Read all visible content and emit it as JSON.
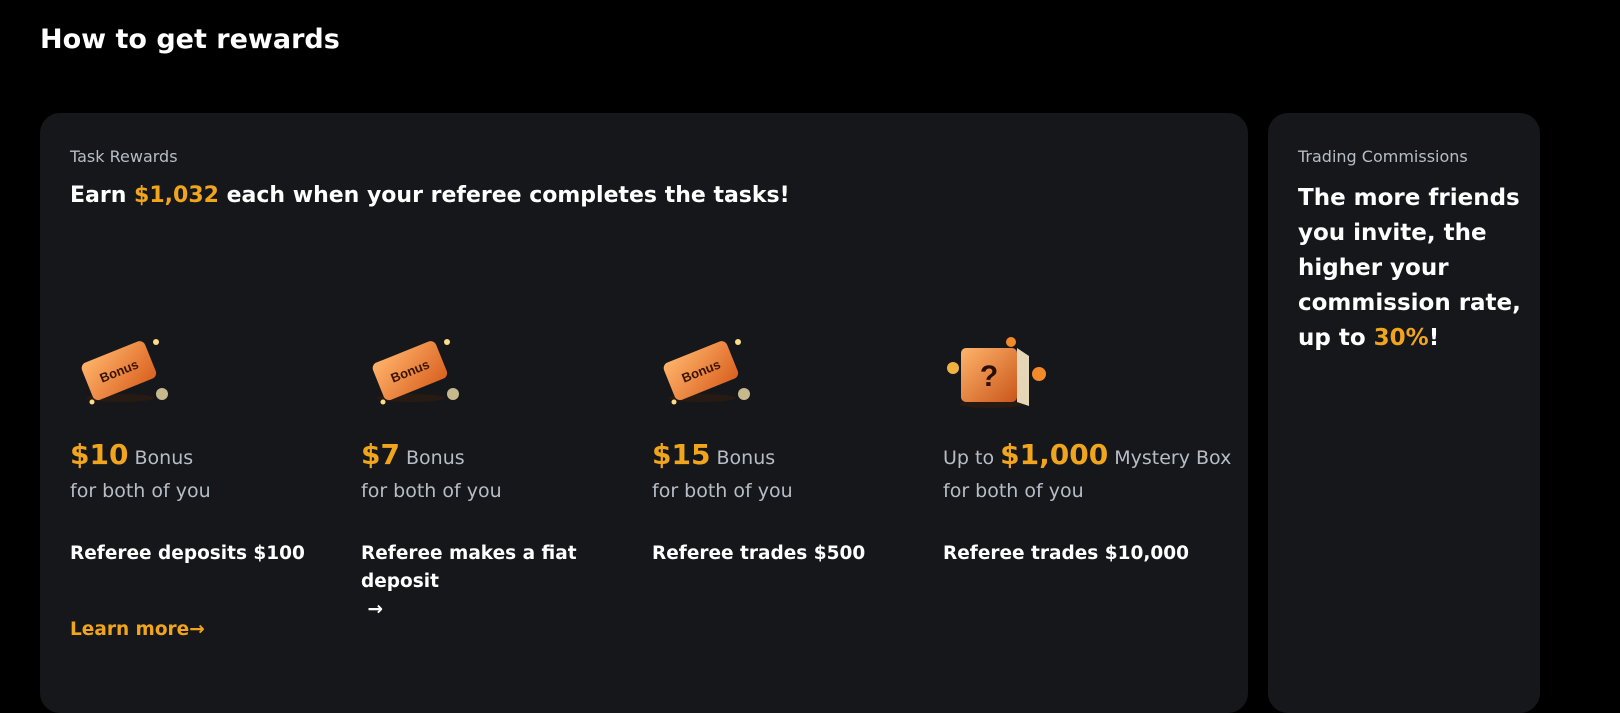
{
  "page": {
    "title": "How to get rewards"
  },
  "task_rewards": {
    "label": "Task Rewards",
    "headline_prefix": "Earn ",
    "headline_amount": "$1,032",
    "headline_suffix": " each when your referee completes the tasks!",
    "tasks": [
      {
        "icon": "bonus-ticket-icon",
        "prefix": "",
        "amount": "$10",
        "type": "Bonus",
        "note": "for both of you",
        "description": "Referee deposits $100",
        "has_arrow": false
      },
      {
        "icon": "bonus-ticket-icon",
        "prefix": "",
        "amount": "$7",
        "type": "Bonus",
        "note": "for both of you",
        "description": "Referee makes a fiat deposit",
        "has_arrow": true
      },
      {
        "icon": "bonus-ticket-icon",
        "prefix": "",
        "amount": "$15",
        "type": "Bonus",
        "note": "for both of you",
        "description": "Referee trades $500",
        "has_arrow": false
      },
      {
        "icon": "mystery-box-icon",
        "prefix": "Up to ",
        "amount": "$1,000",
        "type": "Mystery Box",
        "note": "for both of you",
        "description": "Referee trades $10,000",
        "has_arrow": false
      }
    ],
    "learn_more": "Learn more"
  },
  "trading_commissions": {
    "label": "Trading Commissions",
    "headline_prefix": "The more friends you invite, the higher your commission rate, up to ",
    "headline_amount": "30%",
    "headline_suffix": "!"
  },
  "colors": {
    "accent": "#f0a51c",
    "card_bg": "#16171b",
    "page_bg": "#000000",
    "muted_text": "#b7bdc6"
  },
  "icons": {
    "arrow": "→",
    "bonus_ticket_text": "Bonus",
    "mystery_box_text": "?"
  }
}
